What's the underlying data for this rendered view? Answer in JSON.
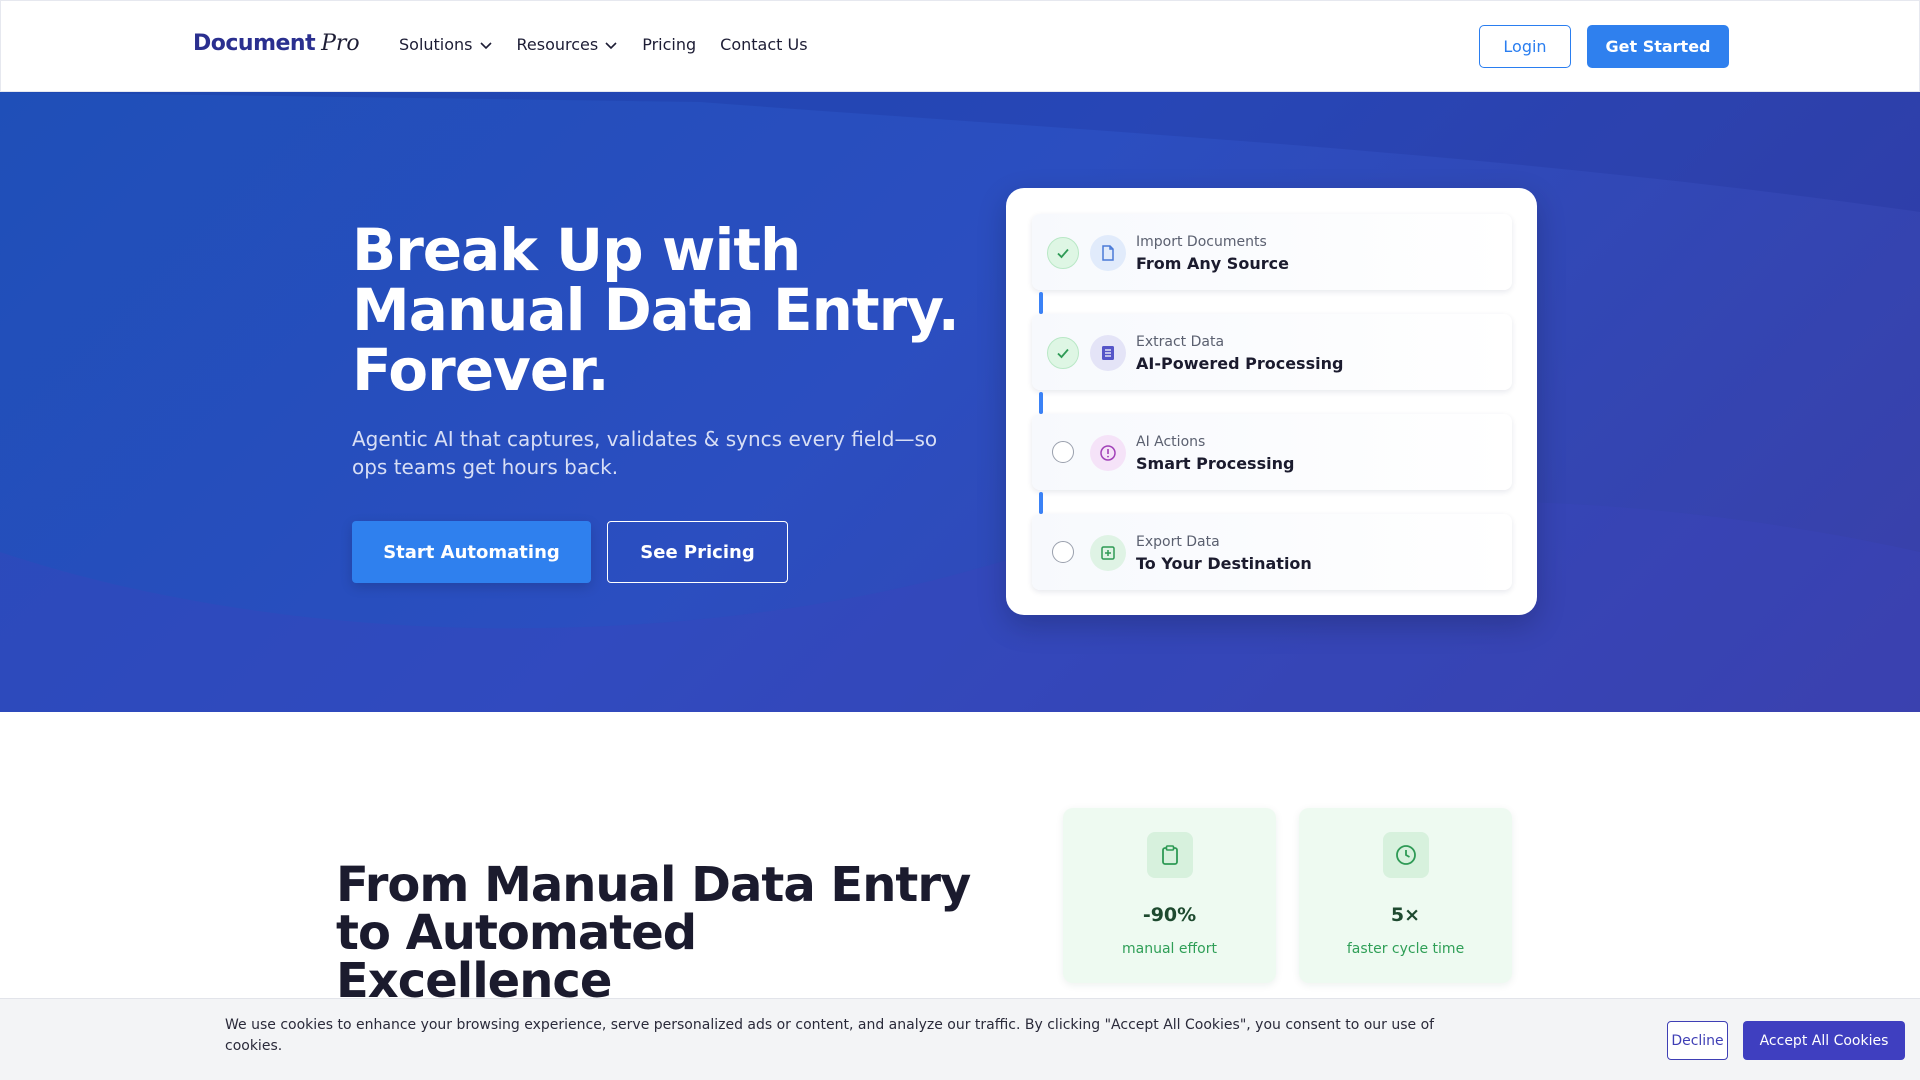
{
  "brand": {
    "name": "Document",
    "suffix": "Pro"
  },
  "nav": {
    "items": [
      {
        "label": "Solutions",
        "has_dropdown": true
      },
      {
        "label": "Resources",
        "has_dropdown": true
      },
      {
        "label": "Pricing",
        "has_dropdown": false
      },
      {
        "label": "Contact Us",
        "has_dropdown": false
      }
    ],
    "login_label": "Login",
    "get_started_label": "Get Started"
  },
  "hero": {
    "title_lines": [
      "Break Up with",
      "Manual Data Entry.",
      "Forever."
    ],
    "subtitle": "Agentic AI that captures, validates & syncs every field—so ops teams get hours back.",
    "primary_cta": "Start Automating",
    "secondary_cta": "See Pricing",
    "colors": {
      "primary": "#2f80ee",
      "hero_bg": "#2b4ec0"
    }
  },
  "workflow": {
    "steps": [
      {
        "label": "Import Documents",
        "detail": "From Any Source",
        "done": true,
        "icon": "document-icon",
        "color": "#4a7bd8"
      },
      {
        "label": "Extract Data",
        "detail": "AI-Powered Processing",
        "done": true,
        "icon": "list-icon",
        "color": "#5555c8"
      },
      {
        "label": "AI Actions",
        "detail": "Smart Processing",
        "done": false,
        "icon": "alert-circle-icon",
        "color": "#a140b8"
      },
      {
        "label": "Export Data",
        "detail": "To Your Destination",
        "done": false,
        "icon": "plus-square-icon",
        "color": "#2e9a55"
      }
    ]
  },
  "section2": {
    "title_lines": [
      "From Manual Data Entry",
      "to Automated",
      "Excellence"
    ],
    "stats": [
      {
        "value": "-90%",
        "label": "manual effort",
        "icon": "clipboard-icon"
      },
      {
        "value": "5×",
        "label": "faster cycle time",
        "icon": "clock-icon"
      }
    ]
  },
  "cookie": {
    "text": "We use cookies to enhance your browsing experience, serve personalized ads or content, and analyze our traffic. By clicking \"Accept All Cookies\", you consent to our use of cookies.",
    "decline_label": "Decline",
    "accept_label": "Accept All Cookies"
  }
}
